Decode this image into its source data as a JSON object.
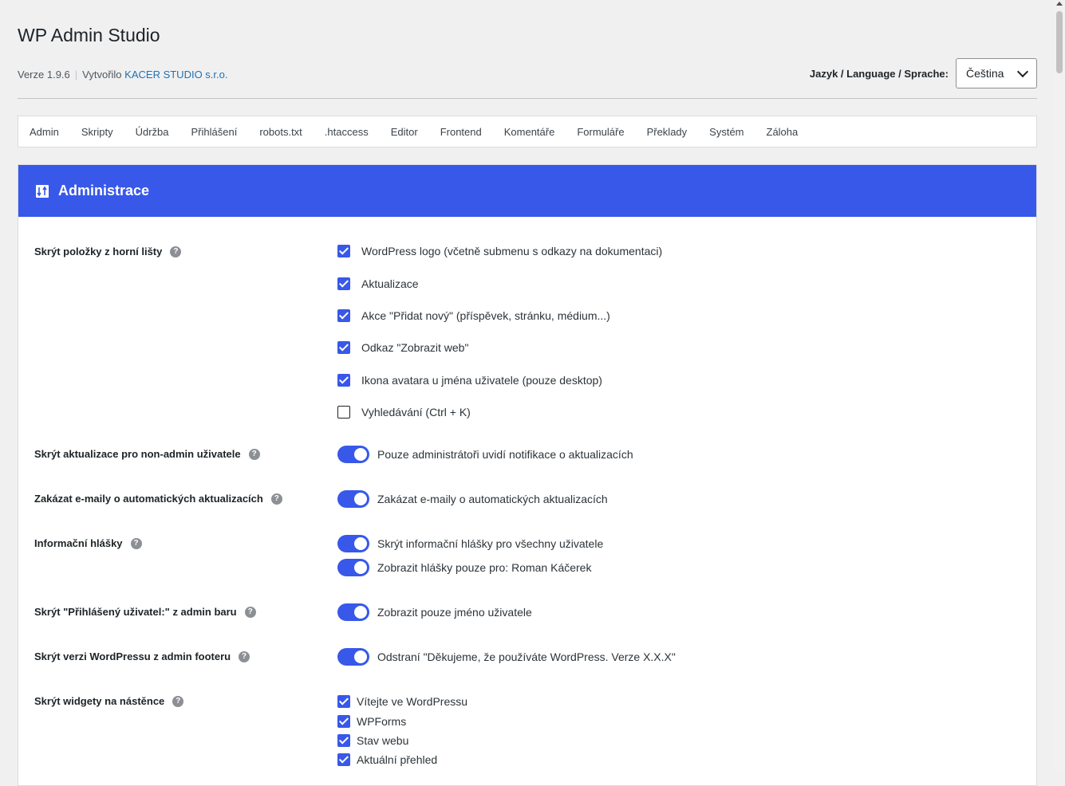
{
  "header": {
    "title": "WP Admin Studio",
    "version": "Verze 1.9.6",
    "created_by": "Vytvořilo",
    "company": "KACER STUDIO s.r.o.",
    "language_label": "Jazyk / Language / Sprache:",
    "language_value": "Čeština"
  },
  "tabs": [
    "Admin",
    "Skripty",
    "Údržba",
    "Přihlášení",
    "robots.txt",
    ".htaccess",
    "Editor",
    "Frontend",
    "Komentáře",
    "Formuláře",
    "Překlady",
    "Systém",
    "Záloha"
  ],
  "panel": {
    "title": "Administrace",
    "accent_color": "#3858e9"
  },
  "settings": {
    "topbar": {
      "label": "Skrýt položky z horní lišty",
      "options": [
        {
          "text": "WordPress logo (včetně submenu s odkazy na dokumentaci)",
          "checked": true
        },
        {
          "text": "Aktualizace",
          "checked": true
        },
        {
          "text": "Akce \"Přidat nový\" (příspěvek, stránku, médium...)",
          "checked": true
        },
        {
          "text": "Odkaz \"Zobrazit web\"",
          "checked": true
        },
        {
          "text": "Ikona avatara u jména uživatele (pouze desktop)",
          "checked": true
        },
        {
          "text": "Vyhledávání (Ctrl + K)",
          "checked": false
        }
      ]
    },
    "updates": {
      "label": "Skrýt aktualizace pro non-admin uživatele",
      "toggle_text": "Pouze administrátoři uvidí notifikace o aktualizacích",
      "enabled": true
    },
    "emails": {
      "label": "Zakázat e-maily o automatických aktualizacích",
      "toggle_text": "Zakázat e-maily o automatických aktualizacích",
      "enabled": true
    },
    "notices": {
      "label": "Informační hlášky",
      "toggle1_text": "Skrýt informační hlášky pro všechny uživatele",
      "toggle2_text": "Zobrazit hlášky pouze pro: Roman Káčerek"
    },
    "howdy": {
      "label": "Skrýt \"Přihlášený uživatel:\" z admin baru",
      "toggle_text": "Zobrazit pouze jméno uživatele",
      "enabled": true
    },
    "footer": {
      "label": "Skrýt verzi WordPressu z admin footeru",
      "toggle_text": "Odstraní \"Děkujeme, že používáte WordPress. Verze X.X.X\"",
      "enabled": true
    },
    "widgets": {
      "label": "Skrýt widgety na nástěnce",
      "options": [
        {
          "text": "Vítejte ve WordPressu",
          "checked": true
        },
        {
          "text": "WPForms",
          "checked": true
        },
        {
          "text": "Stav webu",
          "checked": true
        },
        {
          "text": "Aktuální přehled",
          "checked": true
        }
      ]
    }
  }
}
